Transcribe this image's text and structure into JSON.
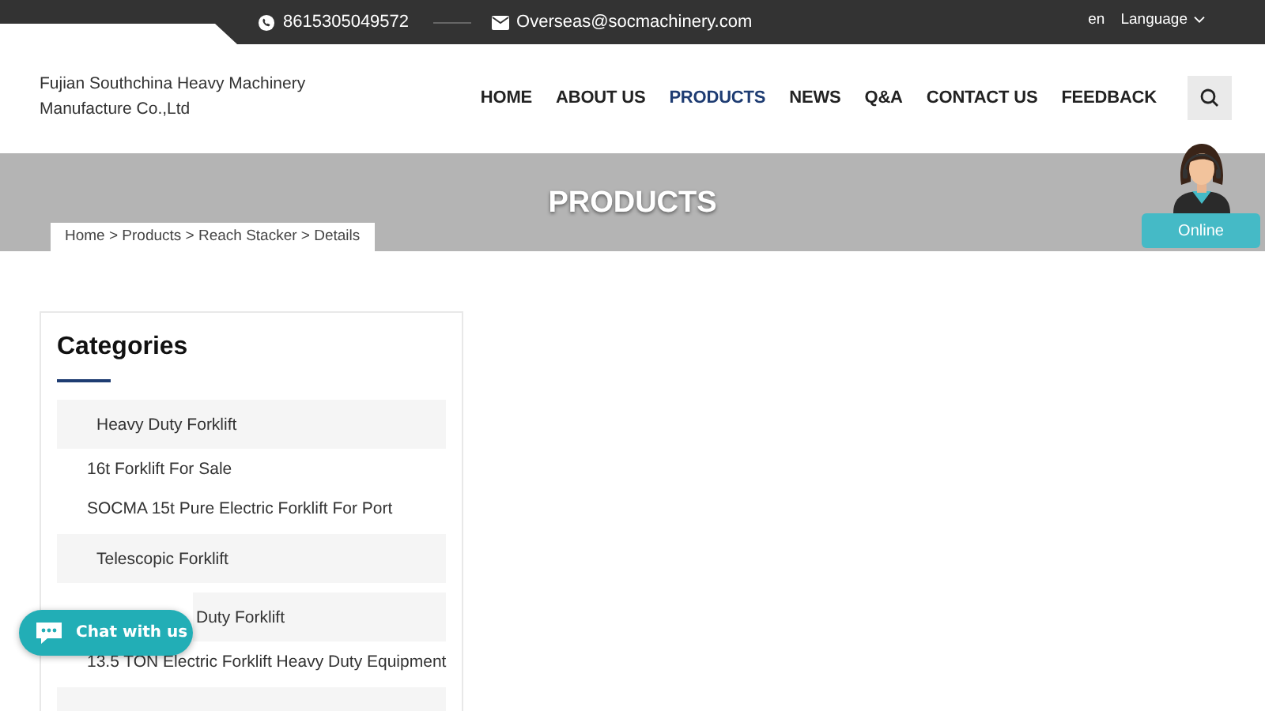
{
  "topbar": {
    "phone": "8615305049572",
    "email": "Overseas@socmachinery.com",
    "lang": "en",
    "language": "Language"
  },
  "header": {
    "company": "Fujian Southchina Heavy Machinery Manufacture Co.,Ltd",
    "nav": [
      {
        "label": "HOME",
        "selected": false
      },
      {
        "label": "ABOUT US",
        "selected": false
      },
      {
        "label": "PRODUCTS",
        "selected": true
      },
      {
        "label": "NEWS",
        "selected": false
      },
      {
        "label": "Q&A",
        "selected": false
      },
      {
        "label": "CONTACT US",
        "selected": false
      },
      {
        "label": "FEEDBACK",
        "selected": false
      }
    ]
  },
  "banner": {
    "title": "PRODUCTS",
    "breadcrumb": "Home > Products > Reach Stacker > Details"
  },
  "categories": {
    "title": "Categories",
    "items": [
      {
        "kind": "group",
        "label": "Heavy Duty Forklift"
      },
      {
        "kind": "product",
        "label": "16t Forklift For Sale"
      },
      {
        "kind": "product",
        "label": "SOCMA 15t Pure Electric Forklift For Port"
      },
      {
        "kind": "group",
        "label": "Telescopic Forklift"
      },
      {
        "kind": "partial",
        "label": "Duty Forklift"
      },
      {
        "kind": "product",
        "label": "13.5 TON Electric Forklift Heavy Duty Equipment"
      },
      {
        "kind": "group"
      }
    ]
  },
  "chat": {
    "label": "Chat with us"
  },
  "agent": {
    "label": "Online"
  }
}
